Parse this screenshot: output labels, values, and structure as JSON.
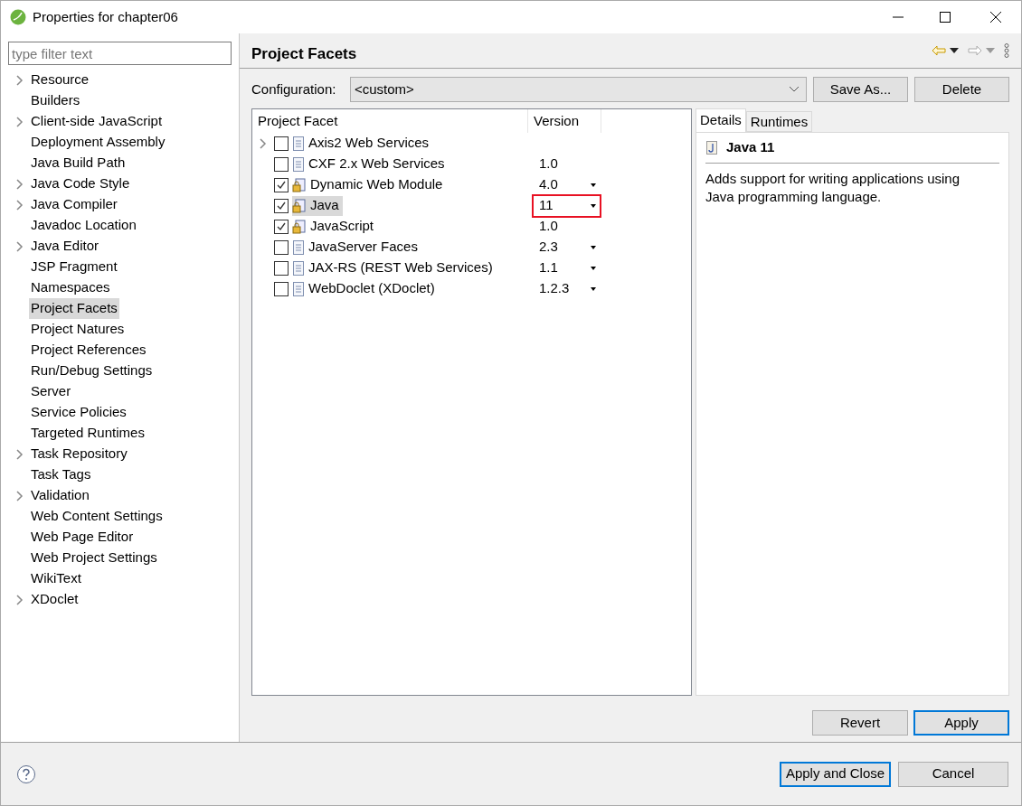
{
  "window": {
    "title": "Properties for chapter06"
  },
  "filter": {
    "placeholder": "type filter text"
  },
  "sidebar": {
    "items": [
      {
        "label": "Resource",
        "expandable": true,
        "selected": false
      },
      {
        "label": "Builders",
        "expandable": false,
        "selected": false
      },
      {
        "label": "Client-side JavaScript",
        "expandable": true,
        "selected": false
      },
      {
        "label": "Deployment Assembly",
        "expandable": false,
        "selected": false
      },
      {
        "label": "Java Build Path",
        "expandable": false,
        "selected": false
      },
      {
        "label": "Java Code Style",
        "expandable": true,
        "selected": false
      },
      {
        "label": "Java Compiler",
        "expandable": true,
        "selected": false
      },
      {
        "label": "Javadoc Location",
        "expandable": false,
        "selected": false
      },
      {
        "label": "Java Editor",
        "expandable": true,
        "selected": false
      },
      {
        "label": "JSP Fragment",
        "expandable": false,
        "selected": false
      },
      {
        "label": "Namespaces",
        "expandable": false,
        "selected": false
      },
      {
        "label": "Project Facets",
        "expandable": false,
        "selected": true
      },
      {
        "label": "Project Natures",
        "expandable": false,
        "selected": false
      },
      {
        "label": "Project References",
        "expandable": false,
        "selected": false
      },
      {
        "label": "Run/Debug Settings",
        "expandable": false,
        "selected": false
      },
      {
        "label": "Server",
        "expandable": false,
        "selected": false
      },
      {
        "label": "Service Policies",
        "expandable": false,
        "selected": false
      },
      {
        "label": "Targeted Runtimes",
        "expandable": false,
        "selected": false
      },
      {
        "label": "Task Repository",
        "expandable": true,
        "selected": false
      },
      {
        "label": "Task Tags",
        "expandable": false,
        "selected": false
      },
      {
        "label": "Validation",
        "expandable": true,
        "selected": false
      },
      {
        "label": "Web Content Settings",
        "expandable": false,
        "selected": false
      },
      {
        "label": "Web Page Editor",
        "expandable": false,
        "selected": false
      },
      {
        "label": "Web Project Settings",
        "expandable": false,
        "selected": false
      },
      {
        "label": "WikiText",
        "expandable": false,
        "selected": false
      },
      {
        "label": "XDoclet",
        "expandable": true,
        "selected": false
      }
    ]
  },
  "page": {
    "title": "Project Facets",
    "configuration": {
      "label": "Configuration:",
      "value": "<custom>"
    },
    "config_buttons": [
      "Save As...",
      "Delete"
    ],
    "table": {
      "columns": [
        "Project Facet",
        "Version"
      ],
      "rows": [
        {
          "name": "Axis2 Web Services",
          "checked": false,
          "expandable": true,
          "selected": false
        },
        {
          "name": "CXF 2.x Web Services",
          "checked": false,
          "expandable": false,
          "selected": false,
          "version": "1.0",
          "dropdown": false,
          "highlighted": false
        },
        {
          "name": "Dynamic Web Module",
          "checked": true,
          "expandable": false,
          "selected": false,
          "version": "4.0",
          "dropdown": true,
          "highlighted": false
        },
        {
          "name": "Java",
          "checked": true,
          "expandable": false,
          "selected": true,
          "version": "11",
          "dropdown": true,
          "highlighted": true
        },
        {
          "name": "JavaScript",
          "checked": true,
          "expandable": false,
          "selected": false,
          "version": "1.0",
          "dropdown": false,
          "highlighted": false
        },
        {
          "name": "JavaServer Faces",
          "checked": false,
          "expandable": false,
          "selected": false,
          "version": "2.3",
          "dropdown": true,
          "highlighted": false
        },
        {
          "name": "JAX-RS (REST Web Services)",
          "checked": false,
          "expandable": false,
          "selected": false,
          "version": "1.1",
          "dropdown": true,
          "highlighted": false
        },
        {
          "name": "WebDoclet (XDoclet)",
          "checked": false,
          "expandable": false,
          "selected": false,
          "version": "1.2.3",
          "dropdown": true,
          "highlighted": false
        }
      ]
    },
    "tabs": [
      {
        "label": "Details",
        "selected": true
      },
      {
        "label": "Runtimes",
        "selected": false
      }
    ],
    "details": {
      "title": "Java 11",
      "description": "Adds support for writing applications using Java programming language."
    },
    "page_buttons": [
      {
        "label": "Revert",
        "default": false
      },
      {
        "label": "Apply",
        "default": true
      }
    ]
  },
  "footer_buttons": [
    {
      "label": "Apply and Close",
      "default": true
    },
    {
      "label": "Cancel",
      "default": false
    }
  ]
}
